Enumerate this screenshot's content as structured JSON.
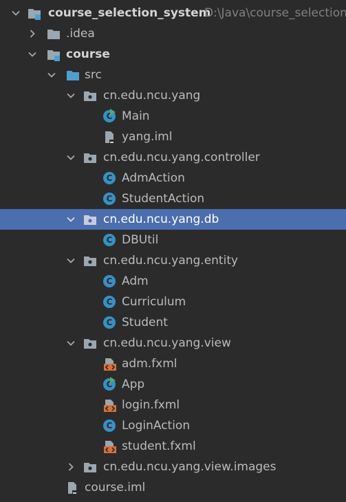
{
  "tree": {
    "root": {
      "label": "course_selection_system",
      "path": "D:\\Java\\course_selection"
    },
    "idea": {
      "label": ".idea"
    },
    "course": {
      "label": "course"
    },
    "src": {
      "label": "src"
    },
    "pkg_yang": {
      "label": "cn.edu.ncu.yang"
    },
    "main": {
      "label": "Main"
    },
    "yang_iml": {
      "label": "yang.iml"
    },
    "pkg_controller": {
      "label": "cn.edu.ncu.yang.controller"
    },
    "adm_action": {
      "label": "AdmAction"
    },
    "student_action": {
      "label": "StudentAction"
    },
    "pkg_db": {
      "label": "cn.edu.ncu.yang.db"
    },
    "dbutil": {
      "label": "DBUtil"
    },
    "pkg_entity": {
      "label": "cn.edu.ncu.yang.entity"
    },
    "adm": {
      "label": "Adm"
    },
    "curriculum": {
      "label": "Curriculum"
    },
    "student": {
      "label": "Student"
    },
    "pkg_view": {
      "label": "cn.edu.ncu.yang.view"
    },
    "adm_fxml": {
      "label": "adm.fxml"
    },
    "app": {
      "label": "App"
    },
    "login_fxml": {
      "label": "login.fxml"
    },
    "login_action": {
      "label": "LoginAction"
    },
    "student_fxml": {
      "label": "student.fxml"
    },
    "pkg_view_images": {
      "label": "cn.edu.ncu.yang.view.images"
    },
    "course_iml": {
      "label": "course.iml"
    }
  },
  "colors": {
    "background": "#2b2b2b",
    "selection": "#4b6eaf",
    "text": "#bbbbbb",
    "class_icon": "#3592c4",
    "fxml_icon": "#d5713a",
    "folder": "#9aa7b0",
    "src_folder": "#4e9fd1"
  }
}
